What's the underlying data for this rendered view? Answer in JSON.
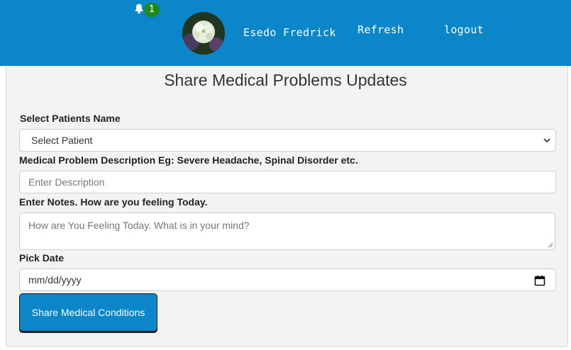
{
  "header": {
    "notification_count": "1",
    "user_name": "Esedo Fredrick",
    "refresh_label": "Refresh",
    "logout_label": "logout",
    "brand_color": "#0a86c9"
  },
  "form": {
    "title": "Share Medical Problems Updates",
    "patient_label": "Select Patients Name",
    "patient_select_value": "Select Patient",
    "description_label": "Medical Problem Description Eg: Severe Headache, Spinal Disorder etc.",
    "description_placeholder": "Enter Description",
    "notes_label": "Enter Notes. How are you feeling Today.",
    "notes_placeholder": "How are You Feeling Today. What is in your mind?",
    "date_label": "Pick Date",
    "date_placeholder": "mm/dd/yyyy",
    "submit_label": "Share Medical Conditions"
  }
}
